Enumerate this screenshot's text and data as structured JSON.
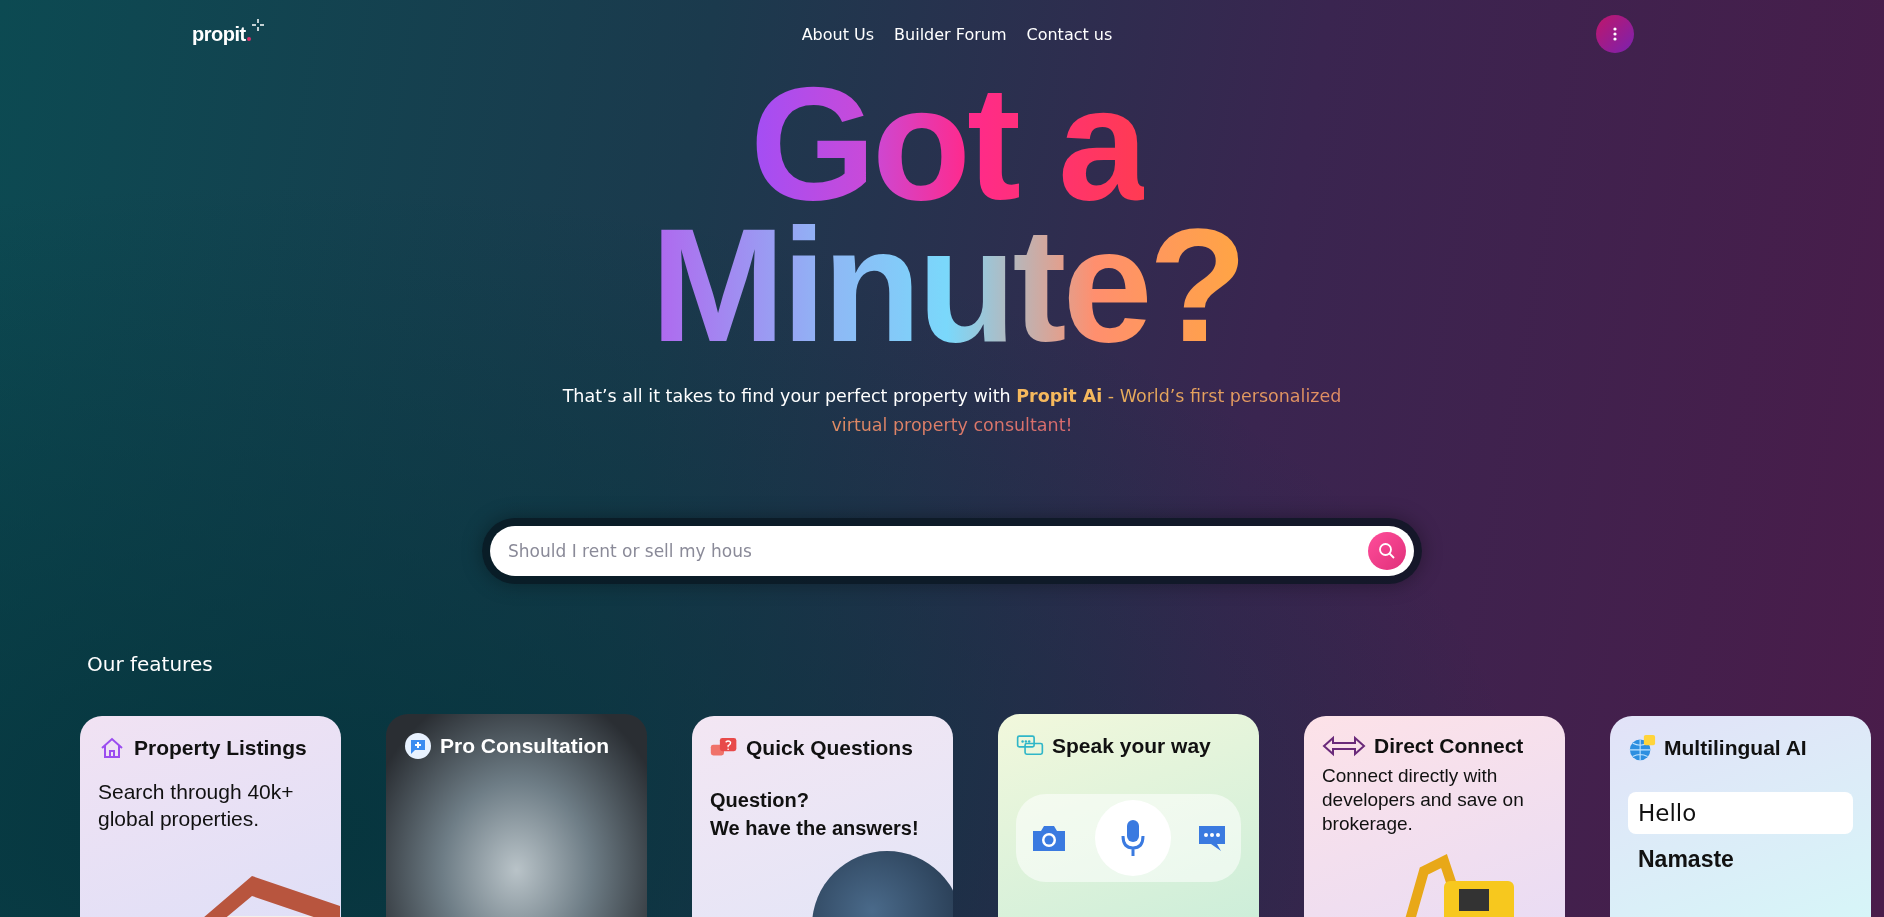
{
  "logo": {
    "text": "propit"
  },
  "nav": {
    "links": [
      "About Us",
      "Builder Forum",
      "Contact us"
    ]
  },
  "headline": {
    "lines": [
      "Got a",
      "Minute?"
    ]
  },
  "tagline": {
    "lead": "That’s all it takes to find your perfect property with",
    "brand": "Propit Ai",
    "rest": "- World’s first personalized virtual property consultant!"
  },
  "search": {
    "placeholder": "Should I rent or sell my hous"
  },
  "features": {
    "heading": "Our features",
    "cards": [
      {
        "kind": "listing",
        "title": "Property Listings",
        "text": "Search through 40k+ global properties."
      },
      {
        "kind": "photo",
        "title": "Pro Consultation"
      },
      {
        "kind": "questions",
        "title": "Quick Questions",
        "text": "Question?\nWe have the answers!"
      },
      {
        "kind": "speak",
        "title": "Speak your way"
      },
      {
        "kind": "connect",
        "title": "Direct Connect",
        "text": "Connect directly with developers and save on brokerage."
      },
      {
        "kind": "multilingual",
        "title": "Multilingual AI",
        "words": [
          "Hello",
          "Namaste"
        ]
      }
    ]
  }
}
